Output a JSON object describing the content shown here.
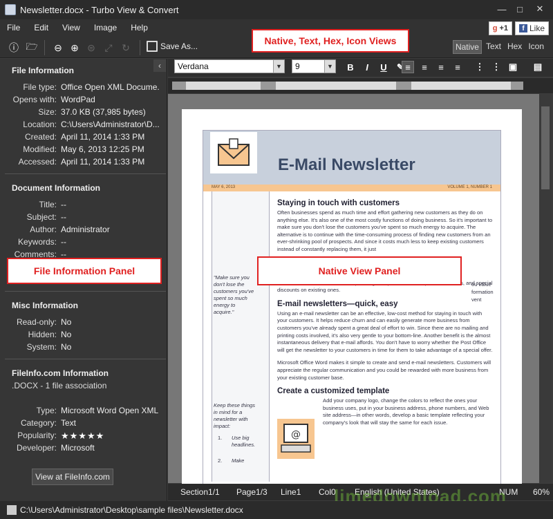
{
  "window": {
    "title": "Newsletter.docx - Turbo View & Convert"
  },
  "menu": [
    "File",
    "Edit",
    "View",
    "Image",
    "Help"
  ],
  "social": {
    "gplus": "+1",
    "fb": "Like"
  },
  "toolbar": {
    "save_as": "Save As..."
  },
  "views": {
    "tabs": [
      "Native",
      "Text",
      "Hex",
      "Icon"
    ],
    "selected": "Native"
  },
  "file_info": {
    "title": "File Information",
    "rows": [
      {
        "label": "File type:",
        "value": "Office Open XML Docume..."
      },
      {
        "label": "Opens with:",
        "value": "WordPad"
      },
      {
        "label": "Size:",
        "value": "37.0 KB (37,985 bytes)"
      },
      {
        "label": "Location:",
        "value": "C:\\Users\\Administrator\\D..."
      },
      {
        "label": "Created:",
        "value": "April 11, 2014 1:33 PM"
      },
      {
        "label": "Modified:",
        "value": "May 6, 2013 12:25 PM"
      },
      {
        "label": "Accessed:",
        "value": "April 11, 2014 1:33 PM"
      }
    ]
  },
  "doc_info": {
    "title": "Document Information",
    "rows": [
      {
        "label": "Title:",
        "value": "--"
      },
      {
        "label": "Subject:",
        "value": "--"
      },
      {
        "label": "Author:",
        "value": "Administrator"
      },
      {
        "label": "Keywords:",
        "value": "--"
      },
      {
        "label": "Comments:",
        "value": "--"
      }
    ]
  },
  "misc_info": {
    "title": "Misc Information",
    "rows": [
      {
        "label": "Read-only:",
        "value": "No"
      },
      {
        "label": "Hidden:",
        "value": "No"
      },
      {
        "label": "System:",
        "value": "No"
      }
    ]
  },
  "fileinfo_com": {
    "title": "FileInfo.com Information",
    "assoc": ".DOCX - 1 file association",
    "rows": [
      {
        "label": "Type:",
        "value": "Microsoft Word Open XML..."
      },
      {
        "label": "Category:",
        "value": "Text"
      },
      {
        "label": "Popularity:",
        "value": ""
      },
      {
        "label": "Developer:",
        "value": "Microsoft"
      }
    ],
    "popularity_stars": 5,
    "button": "View at FileInfo.com"
  },
  "format": {
    "font": "Verdana",
    "size": "9"
  },
  "document": {
    "title": "E-Mail Newsletter",
    "date": "MAY 6, 2013",
    "volume": "VOLUME 1, NUMBER 1",
    "h1": "Staying in touch with customers",
    "p1": "Often businesses spend as much time and effort gathering new customers as they do on anything else. It's also one of the most costly functions of doing business. So it's important to make sure you don't lose the customers you've spent so much energy to acquire. The alternative is to continue with the time-consuming process of finding new customers from an ever-shrinking pool of prospects. And since it costs much less to keep existing customers instead of constantly replacing them, it just",
    "p1b": "announcements, information on upcoming new products and expanded services, and special discounts on existing ones.",
    "h2": "E-mail newsletters—quick, easy",
    "p2": "Using an e-mail newsletter can be an effective, low-cost method for staying in touch with your customers. It helps reduce churn and can easily generate more business from customers you've already spent a great deal of effort to win. Since there are no mailing and printing costs involved, it's also very gentle to your bottom-line. Another benefit is the almost instantaneous delivery that e-mail affords. You don't have to worry whether the Post Office will get the newsletter to your customers in time for them to take advantage of a special offer.",
    "p3": "Microsoft Office Word makes it simple to create and send e-mail newsletters. Customers will appreciate the regular communication and you could be rewarded with more business from your existing customer base.",
    "h3": "Create a customized template",
    "p4": "Add your company logo, change the colors to reflect the ones your business uses, put in your business address, phone numbers, and Web site address—in other words, develop a basic template reflecting your company's look that will stay the same for each issue.",
    "quote1": "\"Make sure you don't lose the customers you've spent so much energy to acquire.\"",
    "quote2": "Keep these things in mind for a newsletter with impact:",
    "list1_num": "1.",
    "list1": "Use big headlines.",
    "list2_num": "2.",
    "list2": "Make",
    "frag1": "ou value",
    "frag2": "formation",
    "frag3": "vent"
  },
  "callouts": {
    "views": "Native, Text, Hex, Icon Views",
    "file_panel": "File Information Panel",
    "native_panel": "Native View Panel"
  },
  "status": {
    "section": "Section1/1",
    "page": "Page1/3",
    "line": "Line1",
    "col": "Col0",
    "lang": "English (United States)",
    "num": "NUM",
    "zoom": "60%"
  },
  "path": "C:\\Users\\Administrator\\Desktop\\sample files\\Newsletter.docx",
  "watermark": "limedownload.com"
}
